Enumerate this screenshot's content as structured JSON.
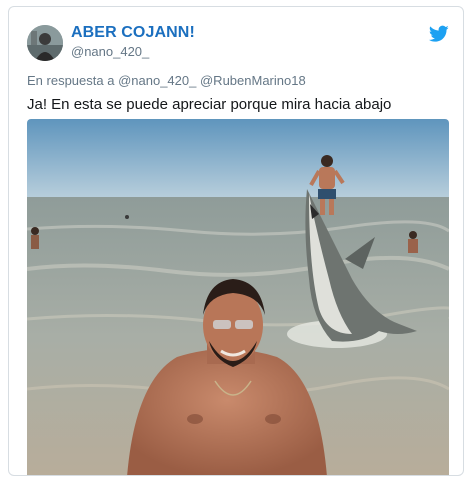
{
  "tweet": {
    "display_name": "ABER COJANN!",
    "handle": "@nano_420_",
    "reply_prefix": "En respuesta a",
    "reply_mentions": [
      "@nano_420_",
      "@RubenMarino18"
    ],
    "text": "Ja! En esta se puede apreciar porque mira hacia abajo",
    "icon": "twitter-bird-icon"
  },
  "colors": {
    "name": "#1b6fbf",
    "handle": "#657786",
    "text": "#14171a",
    "bird": "#1da1f2",
    "sky": "#6fa3c4",
    "sea": "#9aa7a3"
  }
}
